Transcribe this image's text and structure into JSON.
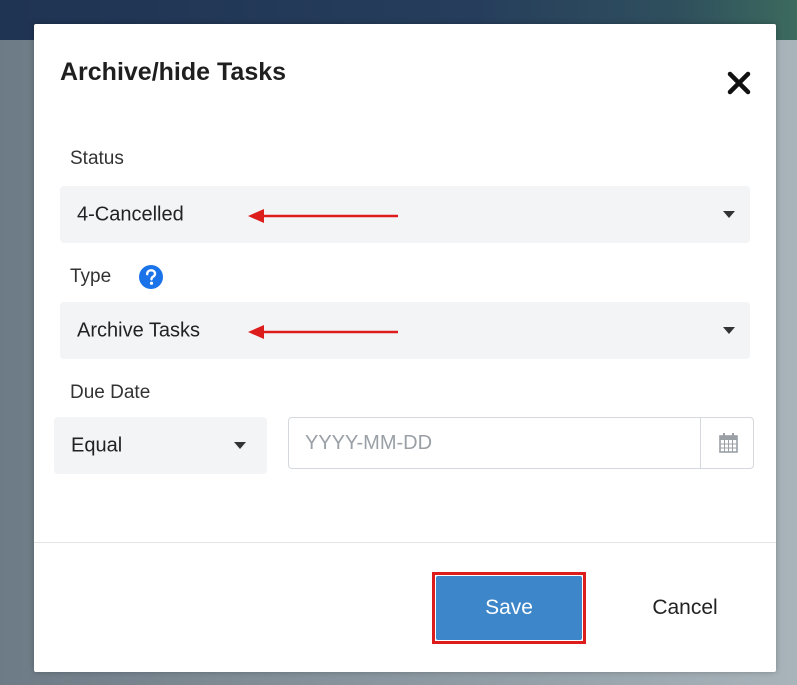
{
  "dialog": {
    "title": "Archive/hide Tasks",
    "close_icon": "close-icon"
  },
  "status": {
    "label": "Status",
    "selected": "4-Cancelled"
  },
  "type": {
    "label": "Type",
    "help_icon": "help-icon",
    "selected": "Archive Tasks"
  },
  "due_date": {
    "label": "Due Date",
    "operator": "Equal",
    "placeholder": "YYYY-MM-DD",
    "calendar_icon": "calendar-icon"
  },
  "footer": {
    "save_label": "Save",
    "cancel_label": "Cancel"
  },
  "colors": {
    "save_button": "#3c86c9",
    "annotation_red": "#dd1c1c",
    "help_icon": "#1a73e8"
  }
}
